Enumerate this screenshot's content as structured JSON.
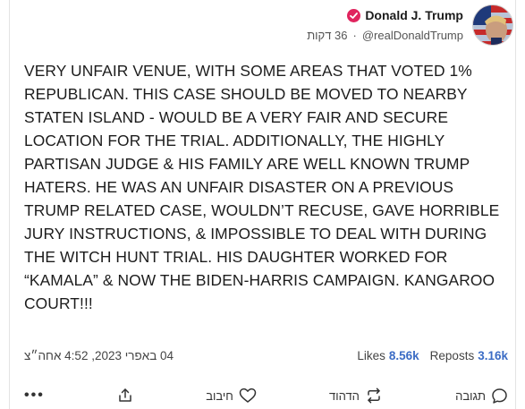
{
  "author": {
    "display_name": "Donald J. Trump",
    "handle": "@realDonaldTrump",
    "time_ago": "36 דקות",
    "separator": "·"
  },
  "post": {
    "text": "VERY UNFAIR VENUE, WITH SOME AREAS THAT VOTED 1% REPUBLICAN. THIS CASE SHOULD BE MOVED TO NEARBY STATEN ISLAND - WOULD BE A VERY FAIR AND SECURE LOCATION FOR THE TRIAL. ADDITIONALLY, THE HIGHLY PARTISAN JUDGE & HIS FAMILY ARE WELL KNOWN TRUMP HATERS. HE WAS AN UNFAIR DISASTER ON A PREVIOUS TRUMP RELATED CASE, WOULDN’T RECUSE, GAVE HORRIBLE JURY INSTRUCTIONS, & IMPOSSIBLE TO DEAL WITH DURING THE WITCH HUNT TRIAL. HIS DAUGHTER WORKED FOR “KAMALA” & NOW THE BIDEN-HARRIS CAMPAIGN. KANGAROO COURT!!!"
  },
  "stats": {
    "date": "04 באפרי 2023, 4:52 אחה״צ",
    "likes_label": "Likes",
    "likes_value": "8.56k",
    "reposts_label": "Reposts",
    "reposts_value": "3.16k"
  },
  "actions": {
    "reply_label": "תגובה",
    "repost_label": "הדהוד",
    "like_label": "חיבוב",
    "more_label": "•••"
  },
  "colors": {
    "accent": "#3b6cc5",
    "verified": "#e0245e"
  },
  "icons": [
    "verified-badge-icon",
    "share-icon",
    "heart-icon",
    "repost-icon",
    "reply-icon",
    "more-icon"
  ]
}
